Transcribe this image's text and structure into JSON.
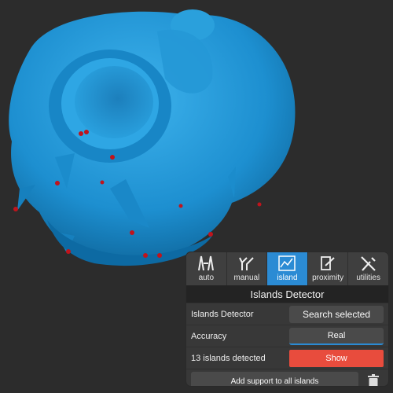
{
  "tabs": [
    {
      "label": "auto",
      "icon": "auto-icon",
      "active": false
    },
    {
      "label": "manual",
      "icon": "manual-icon",
      "active": false
    },
    {
      "label": "island",
      "icon": "island-icon",
      "active": true
    },
    {
      "label": "proximity",
      "icon": "proximity-icon",
      "active": false
    },
    {
      "label": "utilities",
      "icon": "utilities-icon",
      "active": false
    }
  ],
  "panel": {
    "title": "Islands Detector",
    "detector_label": "Islands Detector",
    "detector_button": "Search selected",
    "accuracy_label": "Accuracy",
    "accuracy_value": "Real",
    "status_text": "13 islands detected",
    "show_button": "Show",
    "add_support_button": "Add support to all islands"
  },
  "colors": {
    "model": "#1d8fd0",
    "active_tab": "#2b8bd4",
    "show_button": "#e84c3d",
    "island_marker": "#c0141c",
    "background": "#2c2c2c"
  }
}
